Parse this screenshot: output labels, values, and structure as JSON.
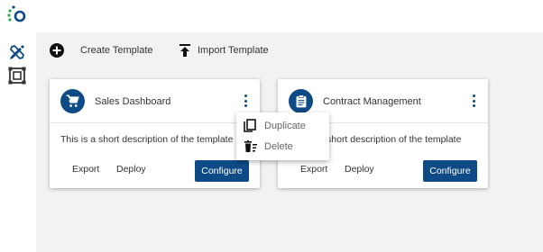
{
  "app": {
    "logo_icon": "spinner-dots-logo-icon"
  },
  "sidebar": {
    "items": [
      {
        "icon": "design-tools-icon"
      },
      {
        "icon": "template-frame-icon"
      }
    ]
  },
  "toolbar": {
    "create_label": "Create Template",
    "import_label": "Import Template"
  },
  "colors": {
    "primary": "#0e4a86",
    "background": "#f2f2f2"
  },
  "cards": [
    {
      "title": "Sales Dashboard",
      "icon": "shopping-cart-icon",
      "description": "This is a short description of the template",
      "export_label": "Export",
      "deploy_label": "Deploy",
      "configure_label": "Configure"
    },
    {
      "title": "Contract Management",
      "icon": "clipboard-icon",
      "description": "This is a short description of the template",
      "export_label": "Export",
      "deploy_label": "Deploy",
      "configure_label": "Configure"
    }
  ],
  "context_menu": {
    "items": [
      {
        "label": "Duplicate",
        "icon": "copy-icon"
      },
      {
        "label": "Delete",
        "icon": "delete-icon"
      }
    ]
  }
}
